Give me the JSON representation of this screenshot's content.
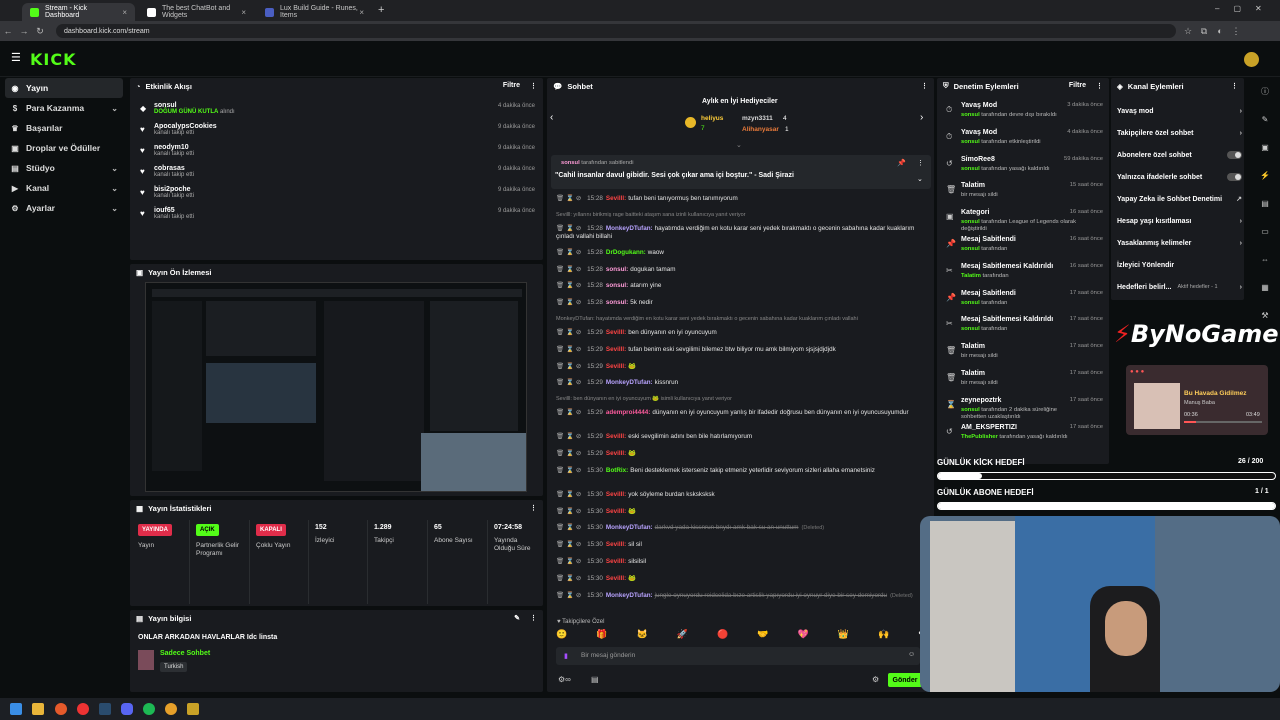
{
  "browser": {
    "tabs": [
      {
        "title": "Stream - Kick Dashboard",
        "active": true,
        "favicon_color": "#53fc18"
      },
      {
        "title": "The best ChatBot and Widgets",
        "active": false,
        "favicon_color": "#ffffff"
      },
      {
        "title": "Lux Build Guide - Runes, Items",
        "active": false,
        "favicon_color": "#4a5ec2"
      }
    ],
    "url": "dashboard.kick.com/stream"
  },
  "logo": "KICK",
  "nav": {
    "items": [
      {
        "label": "Yayın",
        "icon": "broadcast-icon",
        "glyph": "◉",
        "active": true
      },
      {
        "label": "Para Kazanma",
        "icon": "money-icon",
        "glyph": "$",
        "chevron": true
      },
      {
        "label": "Başarılar",
        "icon": "trophy-icon",
        "glyph": "♛"
      },
      {
        "label": "Droplar ve Ödüller",
        "icon": "gift-icon",
        "glyph": "▣"
      },
      {
        "label": "Stüdyo",
        "icon": "studio-icon",
        "glyph": "▤",
        "chevron": true
      },
      {
        "label": "Kanal",
        "icon": "channel-icon",
        "glyph": "▶",
        "chevron": true
      },
      {
        "label": "Ayarlar",
        "icon": "gear-icon",
        "glyph": "⚙",
        "chevron": true
      }
    ]
  },
  "activity": {
    "title": "Etkinlik Akışı",
    "filter": "Filtre",
    "items": [
      {
        "name": "sonsul",
        "desc": "DOĞUM GÜNÜ KUTLA",
        "desc_suffix": " alındı",
        "highlight": true,
        "time": "4 dakika önce"
      },
      {
        "name": "ApocalypsCookies",
        "desc": "kanalı takip etti",
        "time": "9 dakika önce"
      },
      {
        "name": "neodym10",
        "desc": "kanalı takip etti",
        "time": "9 dakika önce"
      },
      {
        "name": "cobrasas",
        "desc": "kanalı takip etti",
        "time": "9 dakika önce"
      },
      {
        "name": "bisi2poche",
        "desc": "kanalı takip etti",
        "time": "9 dakika önce"
      },
      {
        "name": "iouf65",
        "desc": "kanalı takip etti",
        "time": "9 dakika önce"
      }
    ]
  },
  "preview": {
    "title": "Yayın Ön İzlemesi"
  },
  "stats": {
    "title": "Yayın İstatistikleri",
    "items": [
      {
        "value": "YAYINDA",
        "label": "Yayın",
        "pill": "#e02d4a"
      },
      {
        "value": "AÇIK",
        "label": "Partnerlik Gelir Programı",
        "pill": "#53fc18"
      },
      {
        "value": "KAPALI",
        "label": "Çoklu Yayın",
        "pill": "#e02d4a"
      },
      {
        "value": "152",
        "label": "İzleyici"
      },
      {
        "value": "1.289",
        "label": "Takipçi"
      },
      {
        "value": "65",
        "label": "Abone Sayısı"
      },
      {
        "value": "07:24:58",
        "label": "Yayında Olduğu Süre"
      }
    ]
  },
  "info": {
    "title": "Yayın bilgisi",
    "stream_title": "ONLAR ARKADAN HAVLARLAR Idc linsta",
    "category": "Sadece Sohbet",
    "language": "Turkish"
  },
  "chat": {
    "title": "Sohbet",
    "gifters_title": "Aylık en İyi Hediyeciler",
    "gifters": [
      {
        "name": "heliyus",
        "count": "7"
      },
      {
        "name": "mzyn3311",
        "count": "4"
      },
      {
        "name": "Alihanyasar",
        "count": "1"
      }
    ],
    "pinned_by": "sonsul",
    "pinned_by_suffix": " tarafından sabitlendi",
    "pinned_text": "\"Cahil insanlar davul gibidir. Sesi çok çıkar ama içi boştur.\" - Sadi Şirazi",
    "messages": [
      {
        "time": "15:28",
        "user": "Sevilll:",
        "color": "#f44",
        "text": "tufan beni tanıyormuş ben tanımıyorum"
      },
      {
        "sys": true,
        "text": "Sevilll: yıllarını birikmiş rage baitteki ataşım sana izinli kullanıcıya yanıt veriyor"
      },
      {
        "time": "15:28",
        "user": "MonkeyDTufan:",
        "color": "#b8a3ff",
        "text": "hayatımda verdiğim en kotu karar seni yedek bırakmaktı o gecenin sabahına kadar kuaklarım çınladı vallahi billahi"
      },
      {
        "time": "15:28",
        "user": "DrDogukann:",
        "color": "#53fc18",
        "text": "waow"
      },
      {
        "time": "15:28",
        "user": "sonsul:",
        "color": "#ff9bd8",
        "text": "dogukan tamam"
      },
      {
        "time": "15:28",
        "user": "sonsul:",
        "color": "#ff9bd8",
        "text": "atarım yine"
      },
      {
        "time": "15:28",
        "user": "sonsul:",
        "color": "#ff9bd8",
        "text": "5k nedir"
      },
      {
        "sys": true,
        "text": "MonkeyDTufan: hayatımda verdiğim en kotu karar seni yedek bırakmaktı o gecenin sabahına kadar kuaklarım çınladı vallahi"
      },
      {
        "time": "15:29",
        "user": "Sevilll:",
        "color": "#f44",
        "text": "ben dünyanın en iyi oyuncuyum"
      },
      {
        "time": "15:29",
        "user": "Sevilll:",
        "color": "#f44",
        "text": "tufan benim eski sevgilimi bilemez btw biliyor mu amk bilmiyom sjsjsjdjdjdk"
      },
      {
        "time": "15:29",
        "user": "Sevilll:",
        "color": "#f44",
        "text": "🐸"
      },
      {
        "time": "15:29",
        "user": "MonkeyDTufan:",
        "color": "#b8a3ff",
        "text": "kissnrun"
      },
      {
        "sys": true,
        "text": "Sevilll: ben dünyanın en iyi oyuncuyum 🐸 isimli kullanıcıya yanıt veriyor"
      },
      {
        "time": "15:29",
        "user": "ademproi4444:",
        "color": "#ff5b9e",
        "text": "dünyanın en iyi oyuncuyum yanlış bir ifadedir doğrusu ben dünyanın en iyi oyuncusuyumdur"
      },
      {
        "time": "15:29",
        "user": "Sevilll:",
        "color": "#f44",
        "text": "eski sevgilimin adını ben bile hatırlamıyorum"
      },
      {
        "time": "15:29",
        "user": "Sevilll:",
        "color": "#f44",
        "text": "🐸"
      },
      {
        "time": "15:30",
        "user": "BotRix:",
        "color": "#53fc18",
        "text": "Beni desteklemek isterseniz takip etmeniz yeterlidir seviyorum sizleri allaha emanetsiniz"
      },
      {
        "time": "15:30",
        "user": "Sevilll:",
        "color": "#f44",
        "text": "yok söyleme burdan ksksksksk"
      },
      {
        "time": "15:30",
        "user": "Sevilll:",
        "color": "#f44",
        "text": "🐸"
      },
      {
        "time": "15:30",
        "user": "MonkeyDTufan:",
        "color": "#b8a3ff",
        "text": "darkvd yada kissnrun bnydı amk bak su an unuttum",
        "deleted": "(Deleted)"
      },
      {
        "time": "15:30",
        "user": "Sevilll:",
        "color": "#f44",
        "text": "sil sil"
      },
      {
        "time": "15:30",
        "user": "Sevilll:",
        "color": "#f44",
        "text": "silsilsil"
      },
      {
        "time": "15:30",
        "user": "Sevilll:",
        "color": "#f44",
        "text": "🐸"
      },
      {
        "time": "15:30",
        "user": "MonkeyDTufan:",
        "color": "#b8a3ff",
        "text": "jungle oynuyordu reidcelida bıze artislik yapıyordu iyi oynuyr diye bir sey demiyordu",
        "deleted": "(Deleted)"
      }
    ],
    "followers_only": "Takipçilere Özel",
    "input_placeholder": "Bir mesaj gönderin",
    "send": "Gönder"
  },
  "moderation": {
    "title": "Denetim Eylemleri",
    "filter": "Filtre",
    "items": [
      {
        "icon": "slow-mode-icon",
        "glyph": "⏱",
        "action": "Yavaş Mod",
        "user": "sonsul",
        "desc": " tarafından devre dışı bırakıldı",
        "time": "3 dakika önce"
      },
      {
        "icon": "slow-mode-icon",
        "glyph": "⏱",
        "action": "Yavaş Mod",
        "user": "sonsul",
        "desc": " tarafından etkinleştirildi",
        "time": "4 dakika önce"
      },
      {
        "icon": "unban-icon",
        "glyph": "↺",
        "action": "SimoRee8",
        "user": "sonsul",
        "desc": " tarafından yasağı kaldırıldı",
        "time": "59 dakika önce"
      },
      {
        "icon": "delete-icon",
        "glyph": "🗑",
        "action": "Talatim",
        "user": "",
        "desc": "bir mesajı sildi",
        "time": "15 saat önce"
      },
      {
        "icon": "category-icon",
        "glyph": "▣",
        "action": "Kategori",
        "user": "sonsul",
        "desc": " tarafından League of Legends olarak değiştirildi",
        "time": "16 saat önce"
      },
      {
        "icon": "pin-icon",
        "glyph": "📌",
        "action": "Mesaj Sabitlendi",
        "user": "sonsul",
        "desc": " tarafından",
        "time": "16 saat önce"
      },
      {
        "icon": "unpin-icon",
        "glyph": "✂",
        "action": "Mesaj Sabitlemesi Kaldırıldı",
        "user": "Talatim",
        "desc": " tarafından",
        "time": "16 saat önce"
      },
      {
        "icon": "pin-icon",
        "glyph": "📌",
        "action": "Mesaj Sabitlendi",
        "user": "sonsul",
        "desc": " tarafından",
        "time": "17 saat önce"
      },
      {
        "icon": "unpin-icon",
        "glyph": "✂",
        "action": "Mesaj Sabitlemesi Kaldırıldı",
        "user": "sonsul",
        "desc": " tarafından",
        "time": "17 saat önce"
      },
      {
        "icon": "delete-icon",
        "glyph": "🗑",
        "action": "Talatim",
        "user": "",
        "desc": "bir mesajı sildi",
        "time": "17 saat önce"
      },
      {
        "icon": "delete-icon",
        "glyph": "🗑",
        "action": "Talatim",
        "user": "",
        "desc": "bir mesajı sildi",
        "time": "17 saat önce"
      },
      {
        "icon": "timeout-icon",
        "glyph": "⌛",
        "action": "zeynepoztrk",
        "user": "sonsul",
        "desc": " tarafından 2 dakika süreliğine sohbetten uzaklaştırıldı",
        "time": "17 saat önce"
      },
      {
        "icon": "unban-icon",
        "glyph": "↺",
        "action": "AM_EKSPERTIZI",
        "user": "ThePublisher",
        "desc": " tarafından yasağı kaldırıldı",
        "time": "17 saat önce"
      }
    ]
  },
  "channel_actions": {
    "title": "Kanal Eylemleri",
    "items": [
      {
        "label": "Yavaş mod",
        "type": "chevron"
      },
      {
        "label": "Takipçilere özel sohbet",
        "type": "chevron"
      },
      {
        "label": "Abonelere özel sohbet",
        "type": "toggle"
      },
      {
        "label": "Yalnızca ifadelerle sohbet",
        "type": "toggle"
      },
      {
        "label": "Yapay Zeka ile Sohbet Denetimi",
        "type": "ext"
      },
      {
        "label": "Hesap yaşı kısıtlaması",
        "type": "chevron"
      },
      {
        "label": "Yasaklanmış kelimeler",
        "type": "chevron"
      },
      {
        "label": "İzleyici Yönlendir",
        "type": "none"
      },
      {
        "label": "Hedefleri belirl...",
        "type": "goal",
        "extra": "Aktif hedefler - 1"
      }
    ]
  },
  "overlay": {
    "brand": "ByNoGame",
    "song_title": "Bu Havada Gidilmez",
    "artist": "Manuş Baba",
    "elapsed": "00:36",
    "duration": "03:49",
    "follow_goal_label": "GÜNLÜK KİCK HEDEFİ",
    "follow_goal_value": "26 / 200",
    "follow_goal_progress": 0.13,
    "sub_goal_label": "GÜNLÜK ABONE HEDEFİ",
    "sub_goal_value": "1 / 1",
    "sub_goal_progress": 1.0
  }
}
